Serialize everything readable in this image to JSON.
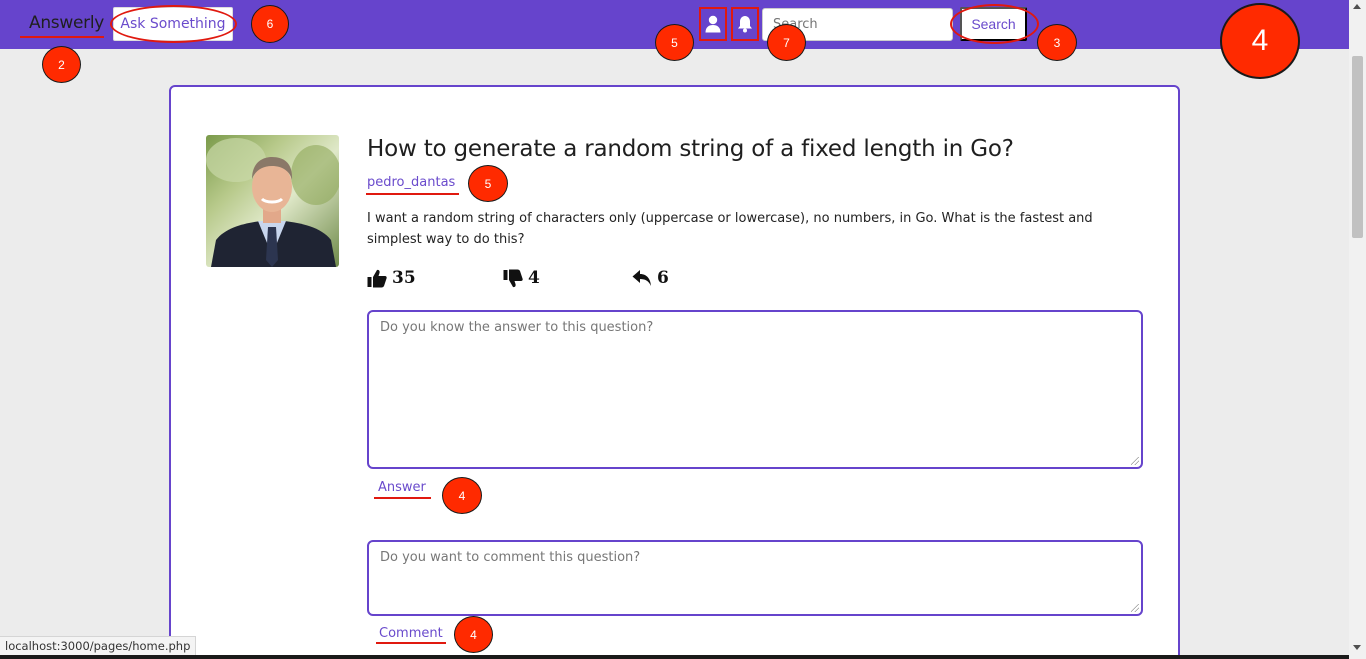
{
  "navbar": {
    "brand": "Answerly",
    "ask_label": "Ask Something",
    "profile_icon": "user-icon",
    "notifications_icon": "bell-icon",
    "search_placeholder": "Search",
    "search_value": "",
    "search_button": "Search",
    "background_color": "#6644cc"
  },
  "annotations": {
    "brand_badge": "2",
    "ask_badge": "6",
    "profile_badge": "5",
    "bell_badge": "7",
    "search_badge": "3",
    "corner_badge": "4",
    "author_badge": "5",
    "answer_badge": "4",
    "comment_badge": "4",
    "highlight_color": "#e0190f",
    "badge_color": "#ff2a00"
  },
  "question": {
    "title": "How to generate a random string of a fixed length in Go?",
    "author": "pedro_dantas",
    "body": "I want a random string of characters only (uppercase or lowercase), no numbers, in Go. What is the fastest and simplest way to do this?",
    "upvotes": "35",
    "downvotes": "4",
    "replies": "6",
    "upvote_icon": "thumbs-up-icon",
    "downvote_icon": "thumbs-down-icon",
    "reply_icon": "reply-icon"
  },
  "answer_form": {
    "placeholder": "Do you know the answer to this question?",
    "submit_label": "Answer"
  },
  "comment_form": {
    "placeholder": "Do you want to comment this question?",
    "submit_label": "Comment"
  },
  "status_bar": {
    "url": "localhost:3000/pages/home.php"
  }
}
